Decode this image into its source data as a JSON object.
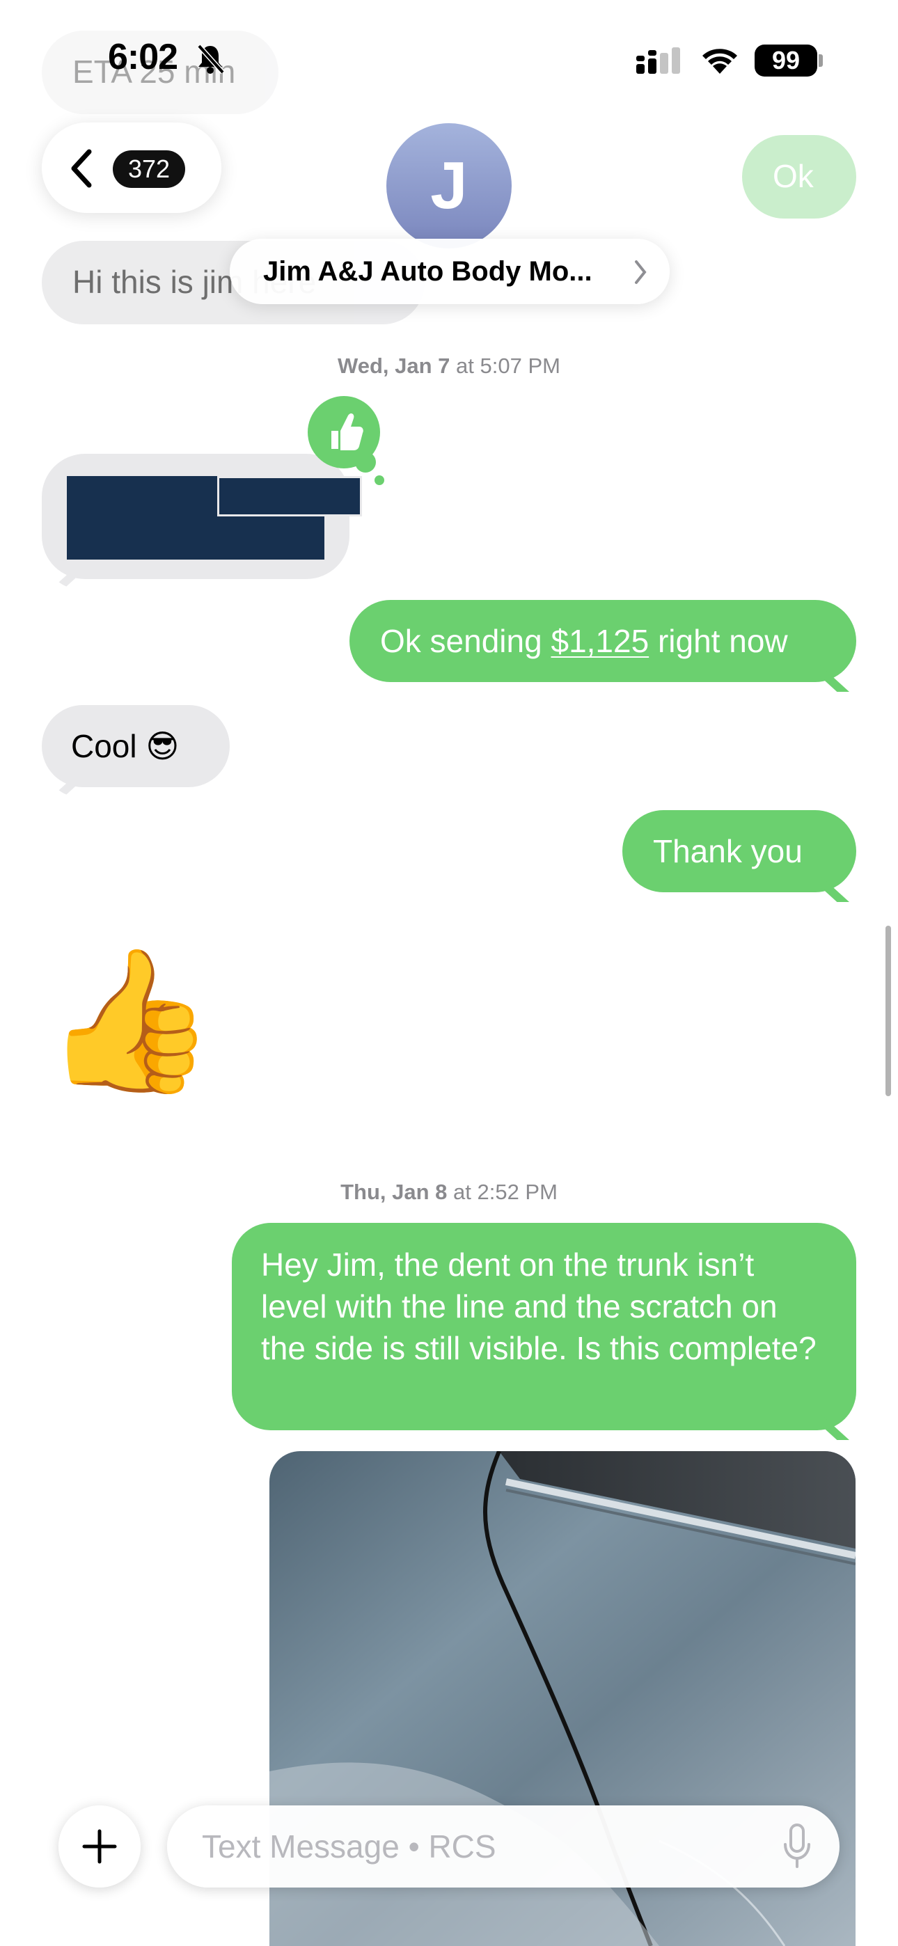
{
  "status_bar": {
    "time": "6:02",
    "battery": "99"
  },
  "header": {
    "unread_count": "372",
    "avatar_initial": "J",
    "contact_name": "Jim A&J Auto Body Mo..."
  },
  "faded_messages": {
    "eta": "ETA 25 min",
    "hi": "Hi this is jim here",
    "ok": "Ok"
  },
  "timestamps": [
    {
      "day": "Wed, Jan 7",
      "time": " at 5:07 PM"
    },
    {
      "day": "Thu, Jan 8",
      "time": " at 2:52 PM"
    }
  ],
  "messages": {
    "sending_prefix": "Ok sending ",
    "sending_amount": "$1,125",
    "sending_suffix": " right now",
    "cool": "Cool 😎",
    "thank_you": "Thank you",
    "thumbs_up": "👍",
    "dent_message": "Hey Jim, the dent on the trunk isn’t level with the line and the scratch on the side is still visible. Is this complete?"
  },
  "input": {
    "placeholder": "Text Message • RCS"
  }
}
